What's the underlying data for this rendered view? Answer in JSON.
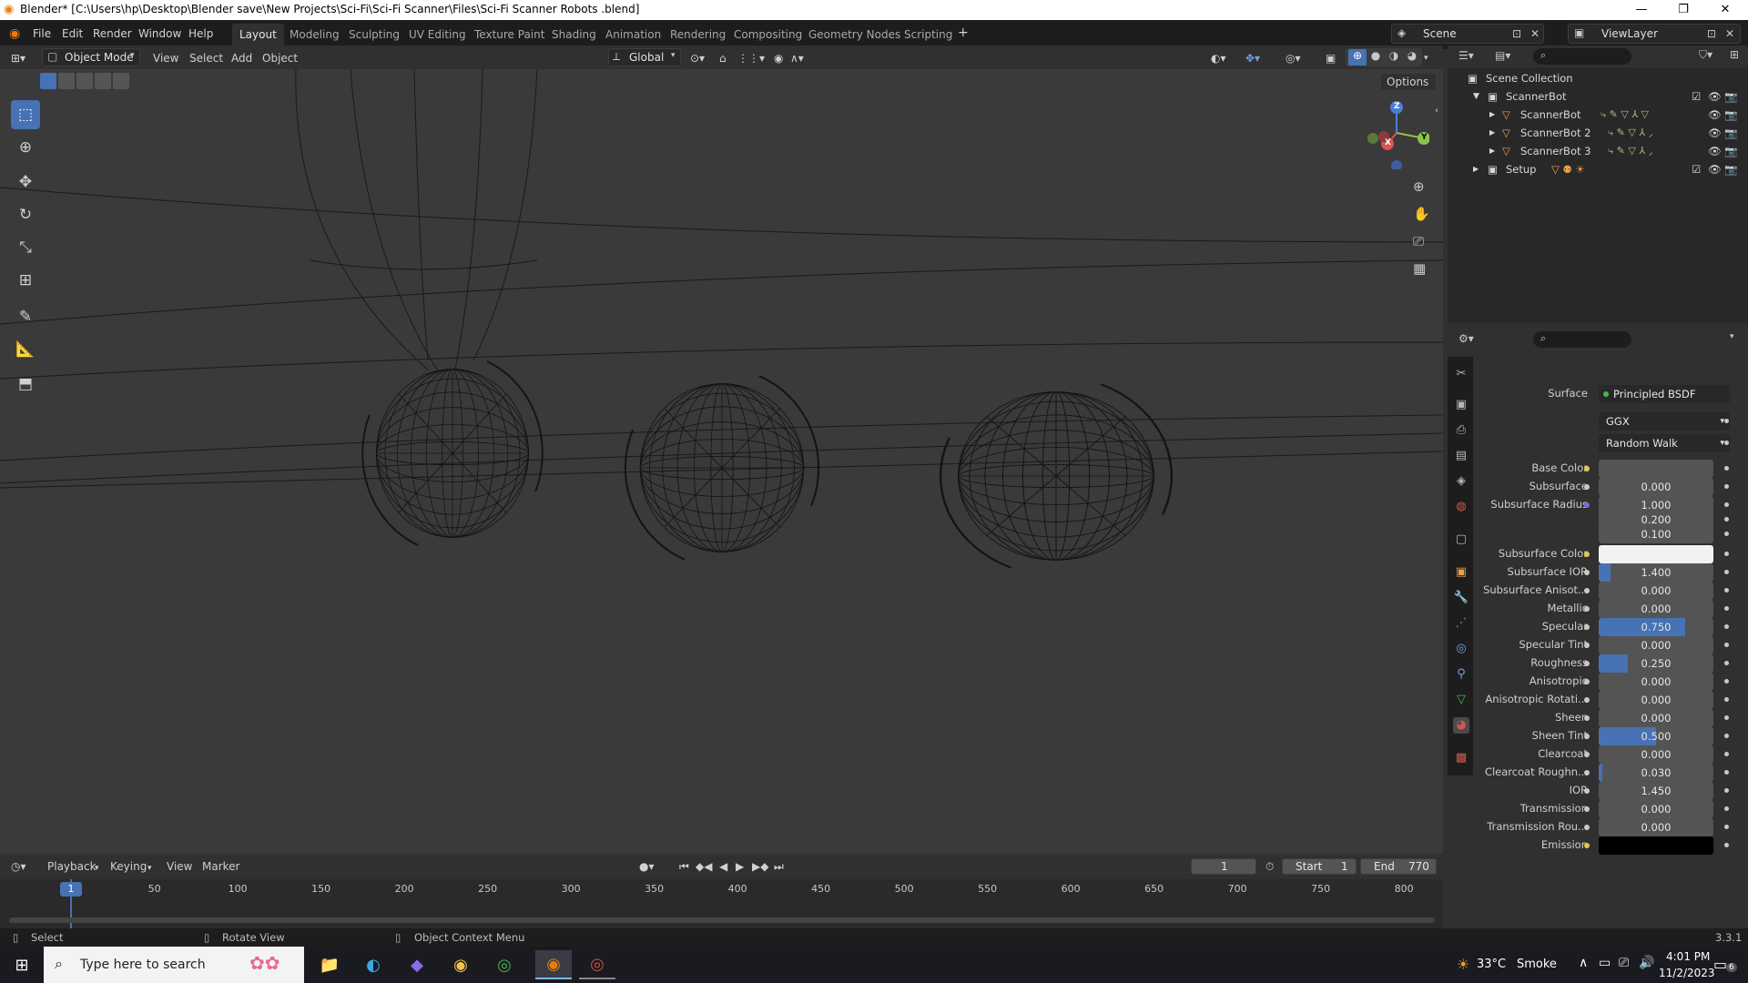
{
  "titlebar": {
    "title": "Blender* [C:\\Users\\hp\\Desktop\\Blender save\\New Projects\\Sci-Fi\\Sci-Fi Scanner\\Files\\Sci-Fi Scanner Robots .blend]"
  },
  "menu": [
    "File",
    "Edit",
    "Render",
    "Window",
    "Help"
  ],
  "workspaces": [
    "Layout",
    "Modeling",
    "Sculpting",
    "UV Editing",
    "Texture Paint",
    "Shading",
    "Animation",
    "Rendering",
    "Compositing",
    "Geometry Nodes",
    "Scripting"
  ],
  "active_workspace": "Layout",
  "scene": {
    "name": "Scene",
    "viewlayer": "ViewLayer"
  },
  "viewport_header": {
    "mode": "Object Mode",
    "menus": [
      "View",
      "Select",
      "Add",
      "Object"
    ],
    "orientation": "Global",
    "options": "Options"
  },
  "gizmo": {
    "x": "X",
    "y": "Y",
    "z": "Z"
  },
  "outliner": {
    "root": "Scene Collection",
    "items": [
      {
        "label": "ScannerBot",
        "depth": 1,
        "type": "collection"
      },
      {
        "label": "ScannerBot",
        "depth": 2,
        "type": "object"
      },
      {
        "label": "ScannerBot 2",
        "depth": 2,
        "type": "object"
      },
      {
        "label": "ScannerBot 3",
        "depth": 2,
        "type": "object"
      },
      {
        "label": "Setup",
        "depth": 1,
        "type": "collection"
      }
    ]
  },
  "properties": {
    "surface_label": "Surface",
    "surface_value": "Principled BSDF",
    "distribution": "GGX",
    "subsurface_method": "Random Walk",
    "rows": [
      {
        "label": "Base Color",
        "value": "",
        "kind": "color",
        "color": "#545454",
        "dot": "#e8c54a"
      },
      {
        "label": "Subsurface",
        "value": "0.000",
        "fill": 0
      },
      {
        "label": "Subsurface Radius",
        "value": "1.000",
        "fill": 0,
        "dot": "#6f6fd8"
      },
      {
        "label": "",
        "value": "0.200",
        "fill": 0,
        "nodot": true
      },
      {
        "label": "",
        "value": "0.100",
        "fill": 0,
        "nodot": true
      },
      {
        "label": "Subsurface Color",
        "value": "",
        "kind": "color",
        "color": "#f2f2f2",
        "dot": "#e8c54a"
      },
      {
        "label": "Subsurface IOR",
        "value": "1.400",
        "fill": 0.1
      },
      {
        "label": "Subsurface Anisot...",
        "value": "0.000",
        "fill": 0
      },
      {
        "label": "Metallic",
        "value": "0.000",
        "fill": 0
      },
      {
        "label": "Specular",
        "value": "0.750",
        "fill": 0.75
      },
      {
        "label": "Specular Tint",
        "value": "0.000",
        "fill": 0
      },
      {
        "label": "Roughness",
        "value": "0.250",
        "fill": 0.25
      },
      {
        "label": "Anisotropic",
        "value": "0.000",
        "fill": 0
      },
      {
        "label": "Anisotropic Rotati...",
        "value": "0.000",
        "fill": 0
      },
      {
        "label": "Sheen",
        "value": "0.000",
        "fill": 0
      },
      {
        "label": "Sheen Tint",
        "value": "0.500",
        "fill": 0.5
      },
      {
        "label": "Clearcoat",
        "value": "0.000",
        "fill": 0
      },
      {
        "label": "Clearcoat Roughn...",
        "value": "0.030",
        "fill": 0.03
      },
      {
        "label": "IOR",
        "value": "1.450",
        "fill": 0
      },
      {
        "label": "Transmission",
        "value": "0.000",
        "fill": 0
      },
      {
        "label": "Transmission Rou...",
        "value": "0.000",
        "fill": 0
      },
      {
        "label": "Emission",
        "value": "",
        "kind": "color",
        "color": "#000000",
        "dot": "#e8c54a"
      }
    ]
  },
  "timeline": {
    "menus": [
      "Playback",
      "Keying",
      "View",
      "Marker"
    ],
    "current_frame": "1",
    "start_label": "Start",
    "start": "1",
    "end_label": "End",
    "end": "770",
    "ticks": [
      "1",
      "50",
      "100",
      "150",
      "200",
      "250",
      "300",
      "350",
      "400",
      "450",
      "500",
      "550",
      "600",
      "650",
      "700",
      "750",
      "800"
    ]
  },
  "statusbar": {
    "select": "Select",
    "rotate": "Rotate View",
    "context": "Object Context Menu",
    "version": "3.3.1"
  },
  "taskbar": {
    "search_placeholder": "Type here to search",
    "weather_temp": "33°C",
    "weather_text": "Smoke",
    "time": "4:01 PM",
    "date": "11/2/2023",
    "notifications": "6"
  }
}
